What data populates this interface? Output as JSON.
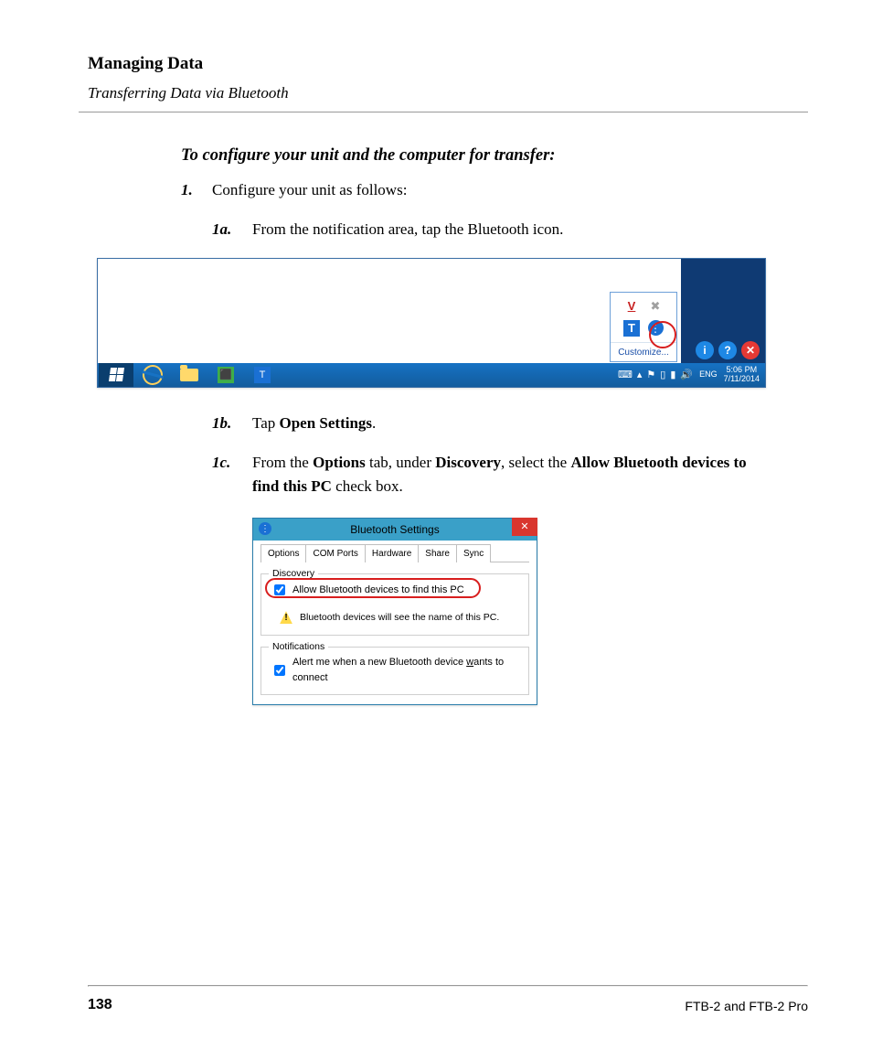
{
  "header": {
    "title": "Managing Data",
    "subtitle": "Transferring Data via Bluetooth"
  },
  "section_title": "To configure your unit and the computer for transfer:",
  "steps": {
    "s1": {
      "num": "1.",
      "text": "Configure your unit as follows:"
    },
    "s1a": {
      "num": "1a.",
      "text": "From the notification area, tap the Bluetooth icon."
    },
    "s1b": {
      "num": "1b.",
      "pre": "Tap ",
      "bold1": "Open Settings",
      "post": "."
    },
    "s1c": {
      "num": "1c.",
      "pre": "From the ",
      "b1": "Options",
      "mid1": " tab, under ",
      "b2": "Discovery",
      "mid2": ", select the ",
      "b3": "Allow Bluetooth devices to find this PC",
      "post": " check box."
    }
  },
  "fig1": {
    "popup": {
      "customize": "Customize...",
      "icons": [
        "V",
        "✖",
        "T",
        "bt"
      ]
    },
    "buttons": {
      "info": "i",
      "help": "?",
      "close": "✕"
    },
    "tray": {
      "eng": "ENG"
    },
    "clock": {
      "time": "5:06 PM",
      "date": "7/11/2014"
    }
  },
  "fig2": {
    "title": "Bluetooth Settings",
    "close": "✕",
    "tabs": [
      "Options",
      "COM Ports",
      "Hardware",
      "Share",
      "Sync"
    ],
    "discovery": {
      "legend": "Discovery",
      "allow": "Allow Bluetooth devices to find this PC",
      "warn": "Bluetooth devices will see the name of this PC."
    },
    "notifications": {
      "legend": "Notifications",
      "alert_pre": "Alert me when a new Bluetooth device ",
      "alert_u": "w",
      "alert_post": "ants to connect"
    }
  },
  "footer": {
    "page": "138",
    "product": "FTB-2 and FTB-2 Pro"
  }
}
